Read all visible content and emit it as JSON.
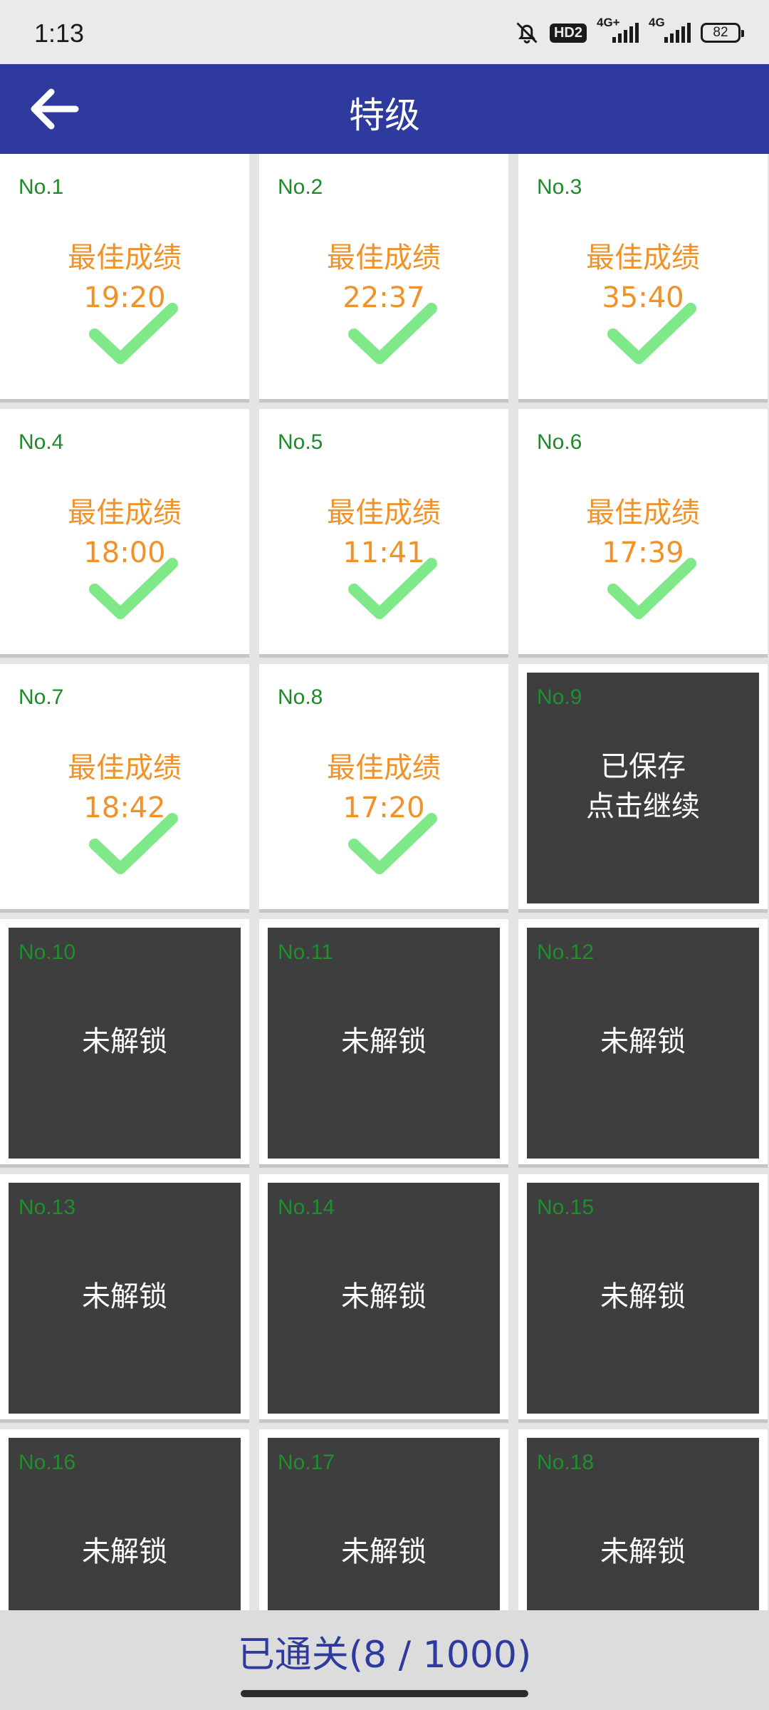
{
  "status": {
    "time": "1:13",
    "hd": "HD2",
    "net1": "4G+",
    "net2": "4G",
    "battery": "82"
  },
  "header": {
    "title": "特级"
  },
  "levels": [
    {
      "num": "No.1",
      "best_label": "最佳成绩",
      "time": "19:20",
      "state": "completed"
    },
    {
      "num": "No.2",
      "best_label": "最佳成绩",
      "time": "22:37",
      "state": "completed"
    },
    {
      "num": "No.3",
      "best_label": "最佳成绩",
      "time": "35:40",
      "state": "completed"
    },
    {
      "num": "No.4",
      "best_label": "最佳成绩",
      "time": "18:00",
      "state": "completed"
    },
    {
      "num": "No.5",
      "best_label": "最佳成绩",
      "time": "11:41",
      "state": "completed"
    },
    {
      "num": "No.6",
      "best_label": "最佳成绩",
      "time": "17:39",
      "state": "completed"
    },
    {
      "num": "No.7",
      "best_label": "最佳成绩",
      "time": "18:42",
      "state": "completed"
    },
    {
      "num": "No.8",
      "best_label": "最佳成绩",
      "time": "17:20",
      "state": "completed"
    },
    {
      "num": "No.9",
      "line1": "已保存",
      "line2": "点击继续",
      "state": "saved"
    },
    {
      "num": "No.10",
      "msg": "未解锁",
      "state": "locked"
    },
    {
      "num": "No.11",
      "msg": "未解锁",
      "state": "locked"
    },
    {
      "num": "No.12",
      "msg": "未解锁",
      "state": "locked"
    },
    {
      "num": "No.13",
      "msg": "未解锁",
      "state": "locked"
    },
    {
      "num": "No.14",
      "msg": "未解锁",
      "state": "locked"
    },
    {
      "num": "No.15",
      "msg": "未解锁",
      "state": "locked"
    },
    {
      "num": "No.16",
      "msg": "未解锁",
      "state": "locked"
    },
    {
      "num": "No.17",
      "msg": "未解锁",
      "state": "locked"
    },
    {
      "num": "No.18",
      "msg": "未解锁",
      "state": "locked"
    }
  ],
  "footer": {
    "progress_text": "已通关(8 / 1000)"
  }
}
